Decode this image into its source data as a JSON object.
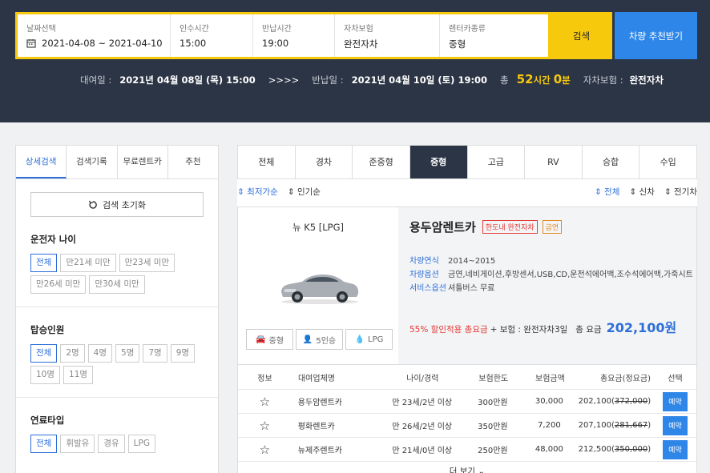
{
  "search": {
    "date_label": "날짜선택",
    "date_value": "2021-04-08 ~ 2021-04-10",
    "pickup_label": "인수시간",
    "pickup_value": "15:00",
    "return_label": "반납시간",
    "return_value": "19:00",
    "insurance_label": "자차보험",
    "insurance_value": "완전자차",
    "cartype_label": "렌터카종류",
    "cartype_value": "중형",
    "search_button": "검색",
    "recommend_button": "차량 추천받기"
  },
  "summary": {
    "rent_label": "대여일 :",
    "rent_value": "2021년 04월 08일 (목) 15:00",
    "arrows": ">>>>",
    "return_label": "반납일 :",
    "return_value": "2021년 04월 10일 (토) 19:00",
    "total_label": "총",
    "hours": "52",
    "hours_unit": "시간",
    "minutes": "0",
    "minutes_unit": "분",
    "insurance_label": "자차보험 :",
    "insurance_value": "완전자차"
  },
  "left_tabs": [
    "상세검색",
    "검색기록",
    "무료렌트카",
    "추천"
  ],
  "reset_label": "검색 초기화",
  "filters": {
    "age": {
      "title": "운전자 나이",
      "options": [
        "전체",
        "만21세 미만",
        "만23세 미만",
        "만26세 미만",
        "만30세 미만"
      ]
    },
    "passengers": {
      "title": "탑승인원",
      "options": [
        "전체",
        "2명",
        "4명",
        "5명",
        "7명",
        "9명",
        "10명",
        "11명"
      ]
    },
    "fuel": {
      "title": "연료타입",
      "options": [
        "전체",
        "휘발유",
        "경유",
        "LPG"
      ]
    }
  },
  "car_tabs": [
    "전체",
    "경차",
    "준중형",
    "중형",
    "고급",
    "RV",
    "승합",
    "수입"
  ],
  "sort_left": [
    "최저가순",
    "인기순"
  ],
  "sort_right": [
    "전체",
    "신차",
    "전기차"
  ],
  "car": {
    "name": "뉴 K5 [LPG]",
    "specs": [
      "중형",
      "5인승",
      "LPG"
    ],
    "company": "용두암렌트카",
    "badge1": "한도내 완전자차",
    "badge2": "금연",
    "year_label": "차량연식",
    "year_value": "2014~2015",
    "options_label": "차량옵션",
    "options_value": "금연,네비게이션,후방센서,USB,CD,운전석에어백,조수석에어백,가죽시트",
    "service_label": "서비스옵션",
    "service_value": "셔틀버스 무료",
    "discount_text": "55% 할인적용 총요금",
    "insurance_text": "+ 보험 : 완전자차3일",
    "total_label": "총 요금",
    "total_amount": "202,100원"
  },
  "table": {
    "headers": [
      "정보",
      "대여업체명",
      "나이/경력",
      "보험한도",
      "보험금액",
      "총요금(정요금)",
      "선택"
    ],
    "rows": [
      {
        "company": "용두암렌트카",
        "age": "만 23세/2년 이상",
        "limit": "300만원",
        "premium": "30,000",
        "price": "202,100",
        "orig": "372,000",
        "action": "예약"
      },
      {
        "company": "평화렌트카",
        "age": "만 26세/2년 이상",
        "limit": "350만원",
        "premium": "7,200",
        "price": "207,100",
        "orig": "281,667",
        "action": "예약"
      },
      {
        "company": "뉴제주렌트카",
        "age": "만 21세/0년 이상",
        "limit": "250만원",
        "premium": "48,000",
        "price": "212,500",
        "orig": "350,000",
        "action": "예약"
      }
    ],
    "more_label": "더 보기 ⌄"
  },
  "colors": {
    "header_bg": "#2c3545",
    "accent_yellow": "#f7c90d",
    "accent_blue": "#2e87e8",
    "badge_red": "#e53935"
  }
}
